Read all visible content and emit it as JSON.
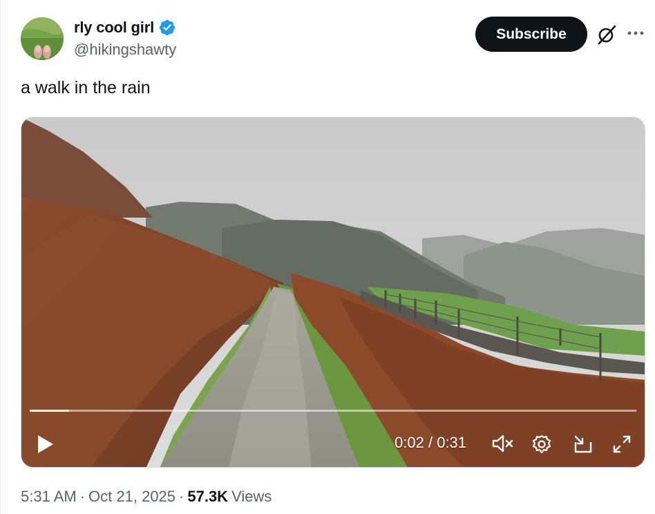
{
  "author": {
    "display_name": "rly cool girl",
    "handle": "@hikingshawty",
    "verified": true,
    "verified_color": "#1d9bf0"
  },
  "header": {
    "subscribe_label": "Subscribe",
    "icons": [
      "grok-icon",
      "more-icon"
    ]
  },
  "tweet": {
    "text": "a walk in the rain"
  },
  "video": {
    "current_time": "0:02",
    "separator": "/",
    "duration": "0:31",
    "progress_fraction": 0.065,
    "controls": [
      "play-icon",
      "mute-icon",
      "settings-icon",
      "popout-icon",
      "fullscreen-icon"
    ]
  },
  "footer": {
    "time": "5:31 AM",
    "dot1": "·",
    "date": "Oct 21, 2025",
    "dot2": "·",
    "views_count": "57.3K",
    "views_label": "Views"
  }
}
